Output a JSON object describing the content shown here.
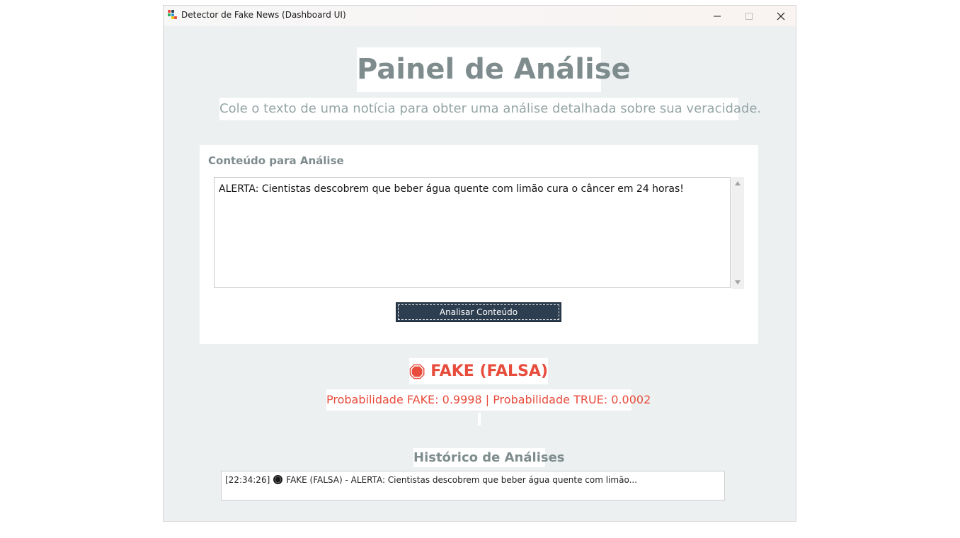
{
  "window": {
    "title": "Detector de Fake News (Dashboard UI)",
    "minimize_icon": "minimize-icon",
    "maximize_icon": "maximize-icon",
    "close_icon": "close-icon"
  },
  "header": {
    "title": "Painel de Análise",
    "subtitle": "Cole o texto de uma notícia para obter uma análise detalhada sobre sua veracidade."
  },
  "input_card": {
    "label": "Conteúdo para Análise",
    "text_value": "ALERTA: Cientistas descobrem que beber água quente com limão cura o câncer em 24 horas!",
    "analyze_button": "Analisar Conteúdo"
  },
  "result": {
    "icon": "stop-sign-icon",
    "label": "FAKE (FALSA)",
    "probabilities": "Probabilidade FAKE: 0.9998 | Probabilidade TRUE: 0.0002"
  },
  "history": {
    "title": "Histórico de Análises",
    "items": [
      {
        "time": "[22:34:26]",
        "icon": "black-circle-icon",
        "text": "FAKE (FALSA) - ALERTA: Cientistas descobrem que beber água quente com limão..."
      }
    ]
  },
  "colors": {
    "background": "#ecf0f1",
    "title_gray": "#7f8c8d",
    "subtitle_gray": "#95a5a6",
    "button_dark": "#2c3e50",
    "fake_red": "#e74c3c"
  }
}
